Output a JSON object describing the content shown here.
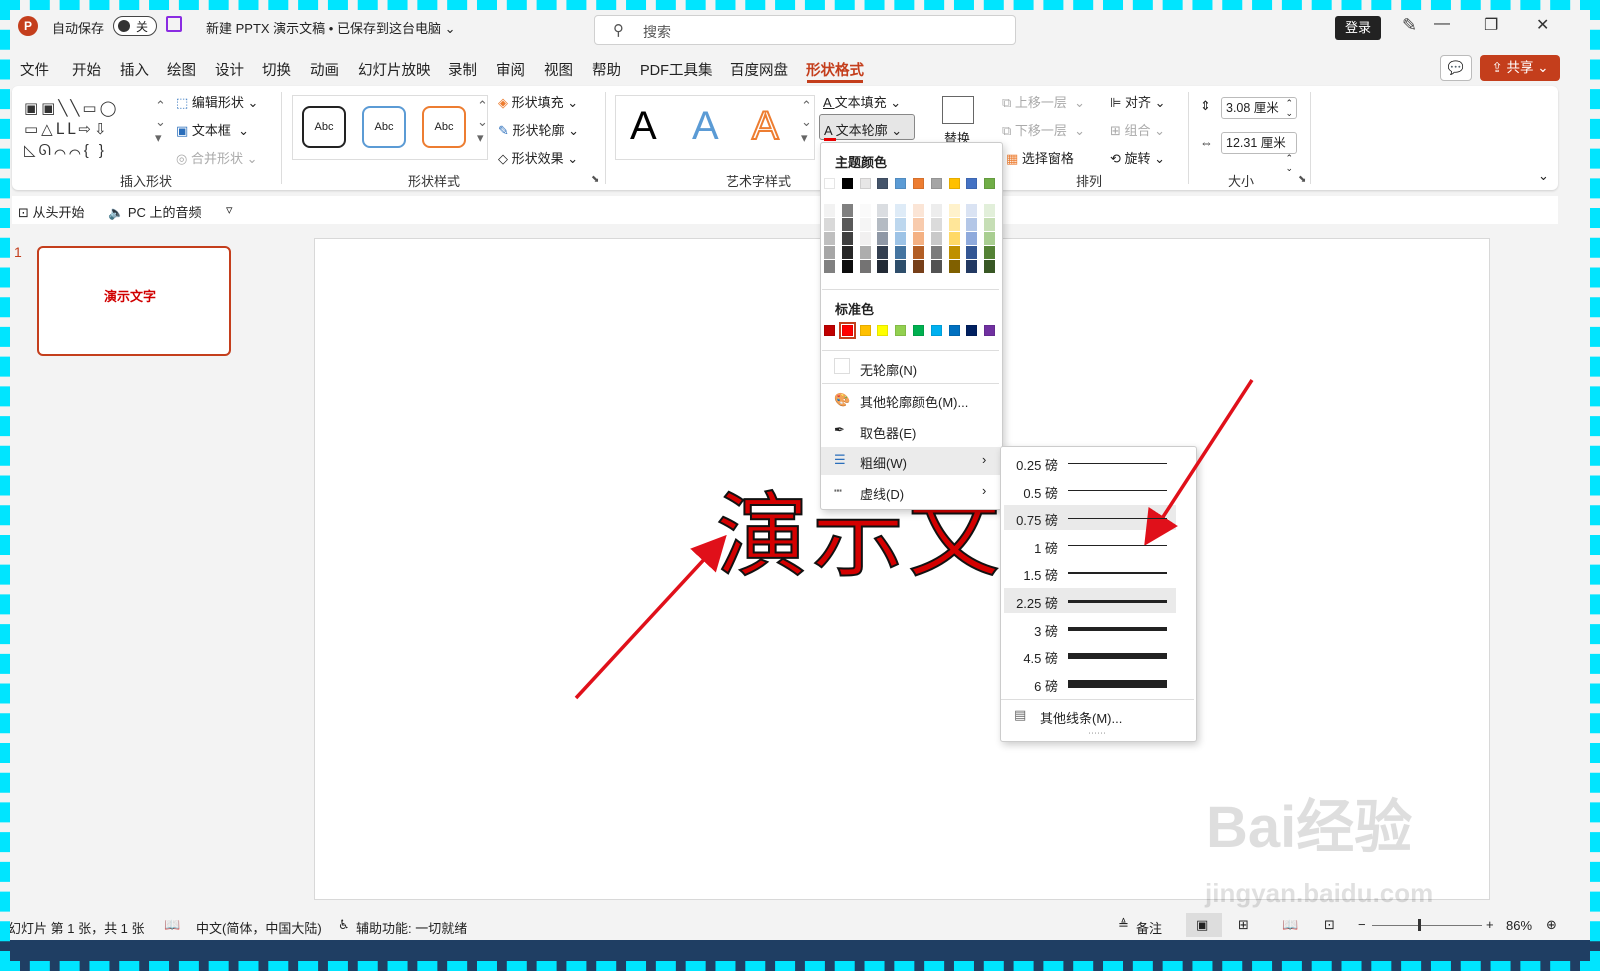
{
  "titlebar": {
    "autosave_label": "自动保存",
    "toggle_state": "关",
    "doc_title": "新建 PPTX 演示文稿 • 已保存到这台电脑 ⌄",
    "search_placeholder": "搜索",
    "login": "登录"
  },
  "menu_tabs": [
    "文件",
    "开始",
    "插入",
    "绘图",
    "设计",
    "切换",
    "动画",
    "幻灯片放映",
    "录制",
    "审阅",
    "视图",
    "帮助",
    "PDF工具集",
    "百度网盘",
    "形状格式"
  ],
  "share_label": "共享",
  "ribbon": {
    "groups": {
      "insert_shape": "插入形状",
      "shape_styles": "形状样式",
      "art_styles": "艺术字样式",
      "arrange": "排列",
      "size": "大小"
    },
    "edit_shape": "编辑形状",
    "textbox": "文本框",
    "merge_shape": "合并形状",
    "style_sample": "Abc",
    "shape_fill": "形状填充",
    "shape_outline": "形状轮廓",
    "shape_effect": "形状效果",
    "text_fill": "文本填充",
    "text_outline": "文本轮廓",
    "replace": "替换",
    "bring_forward": "上移一层",
    "send_backward": "下移一层",
    "selection_pane": "选择窗格",
    "align": "对齐",
    "group": "组合",
    "rotate": "旋转",
    "height": "3.08 厘米",
    "width": "12.31 厘米",
    "art_letter": "A"
  },
  "qat": {
    "from_start": "从头开始",
    "audio": "PC 上的音频"
  },
  "slide_panel": {
    "number": "1",
    "thumb_text": "演示文字"
  },
  "slide": {
    "text": "演示文字"
  },
  "outline_menu": {
    "theme_colors_title": "主题颜色",
    "theme_colors": [
      "#ffffff",
      "#000000",
      "#e7e6e6",
      "#44546a",
      "#5b9bd5",
      "#ed7d31",
      "#a5a5a5",
      "#ffc000",
      "#4472c4",
      "#70ad47"
    ],
    "standard_colors_title": "标准色",
    "standard_colors": [
      "#c00000",
      "#ff0000",
      "#ffc000",
      "#ffff00",
      "#92d050",
      "#00b050",
      "#00b0f0",
      "#0070c0",
      "#002060",
      "#7030a0"
    ],
    "no_outline": "无轮廓(N)",
    "more_colors": "其他轮廓颜色(M)...",
    "eyedropper": "取色器(E)",
    "weight": "粗细(W)",
    "dashes": "虚线(D)"
  },
  "weight_menu": {
    "items": [
      {
        "label": "0.25 磅",
        "pt": 0.25
      },
      {
        "label": "0.5 磅",
        "pt": 0.5
      },
      {
        "label": "0.75 磅",
        "pt": 0.75
      },
      {
        "label": "1 磅",
        "pt": 1
      },
      {
        "label": "1.5 磅",
        "pt": 1.5
      },
      {
        "label": "2.25 磅",
        "pt": 2.25
      },
      {
        "label": "3 磅",
        "pt": 3
      },
      {
        "label": "4.5 磅",
        "pt": 4.5
      },
      {
        "label": "6 磅",
        "pt": 6
      }
    ],
    "more_lines": "其他线条(M)..."
  },
  "status": {
    "slide_info": "幻灯片 第 1 张，共 1 张",
    "language": "中文(简体，中国大陆)",
    "accessibility": "辅助功能: 一切就绪",
    "notes": "备注",
    "zoom": "86%"
  },
  "watermark": {
    "brand": "Bai经验",
    "url": "jingyan.baidu.com"
  }
}
